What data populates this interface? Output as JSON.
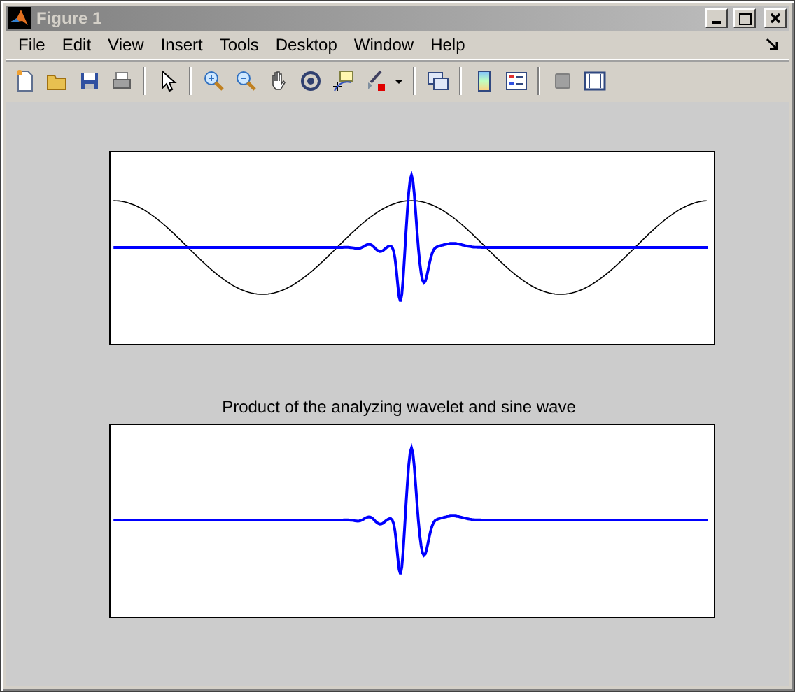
{
  "window": {
    "title": "Figure 1"
  },
  "menu": [
    "File",
    "Edit",
    "View",
    "Insert",
    "Tools",
    "Desktop",
    "Window",
    "Help"
  ],
  "axes": [
    {
      "sine_curve": true
    },
    {
      "title": "Product of the analyzing wavelet and sine wave"
    }
  ]
}
